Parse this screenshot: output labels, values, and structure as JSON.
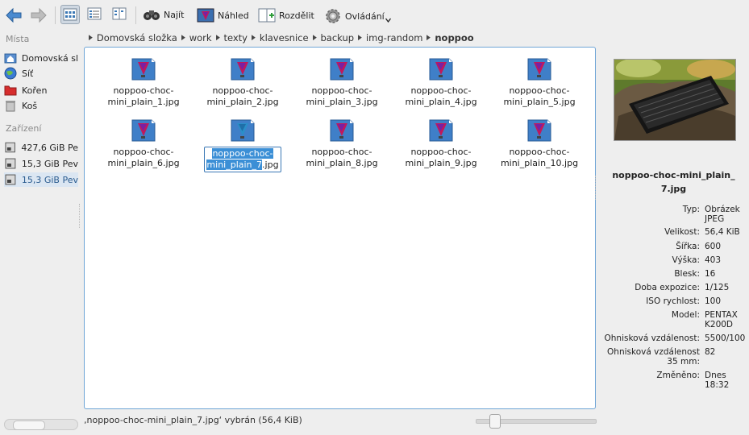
{
  "toolbar": {
    "back_icon": "arrow-left-icon",
    "forward_icon": "arrow-right-icon",
    "find_label": "Najít",
    "preview_label": "Náhled",
    "split_label": "Rozdělit",
    "control_label": "Ovládání"
  },
  "breadcrumb": [
    "Domovská složka",
    "work",
    "texty",
    "klavesnice",
    "backup",
    "img-random",
    "noppoo"
  ],
  "sidebar": {
    "places_title": "Místa",
    "places": [
      "Domovská sl",
      "Síť",
      "Kořen",
      "Koš"
    ],
    "devices_title": "Zařízení",
    "devices": [
      "427,6 GiB Pe",
      "15,3 GiB Pev",
      "15,3 GiB Pev"
    ]
  },
  "files": [
    {
      "l1": "noppoo-choc-",
      "l2": "mini_plain_1.jpg"
    },
    {
      "l1": "noppoo-choc-",
      "l2": "mini_plain_2.jpg"
    },
    {
      "l1": "noppoo-choc-",
      "l2": "mini_plain_3.jpg"
    },
    {
      "l1": "noppoo-choc-",
      "l2": "mini_plain_4.jpg"
    },
    {
      "l1": "noppoo-choc-",
      "l2": "mini_plain_5.jpg"
    },
    {
      "l1": "noppoo-choc-",
      "l2": "mini_plain_6.jpg"
    },
    {
      "l1": "noppoo-choc-",
      "l2a": "mini_plain_7",
      "l2b": ".jpg"
    },
    {
      "l1": "noppoo-choc-",
      "l2": "mini_plain_8.jpg"
    },
    {
      "l1": "noppoo-choc-",
      "l2": "mini_plain_9.jpg"
    },
    {
      "l1": "noppoo-choc-",
      "l2": "mini_plain_10.jpg"
    }
  ],
  "info": {
    "title": "noppoo-choc-mini_plain_7.jpg",
    "rows": [
      {
        "k": "Typ:",
        "v": "Obrázek JPEG"
      },
      {
        "k": "Velikost:",
        "v": "56,4 KiB"
      },
      {
        "k": "Šířka:",
        "v": "600"
      },
      {
        "k": "Výška:",
        "v": "403"
      },
      {
        "k": "Blesk:",
        "v": "16"
      },
      {
        "k": "Doba expozice:",
        "v": "1/125"
      },
      {
        "k": "ISO rychlost:",
        "v": "100"
      },
      {
        "k": "Model:",
        "v": "PENTAX K200D"
      },
      {
        "k": "Ohnisková vzdálenost:",
        "v": "5500/100"
      },
      {
        "k": "Ohnisková vzdálenost 35 mm:",
        "v": "82"
      },
      {
        "k": "Změněno:",
        "v": "Dnes 18:32"
      }
    ]
  },
  "status_text": "‚noppoo-choc-mini_plain_7.jpg‘ vybrán (56,4 KiB)",
  "zoom_level": 0.12,
  "colors": {
    "accent": "#3b8fd6",
    "frame": "#6fa5d6"
  }
}
